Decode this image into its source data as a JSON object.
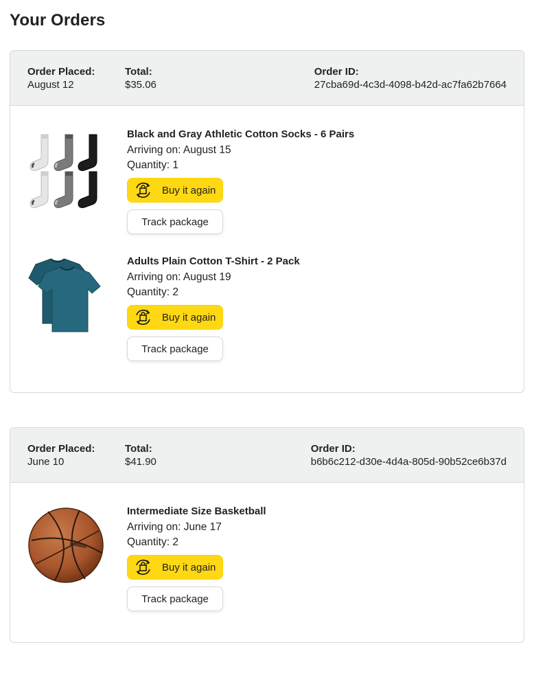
{
  "page": {
    "title": "Your Orders"
  },
  "labels": {
    "order_placed": "Order Placed:",
    "total": "Total:",
    "order_id": "Order ID:",
    "arriving_prefix": "Arriving on: ",
    "quantity_prefix": "Quantity: ",
    "buy_again": "Buy it again",
    "track_package": "Track package"
  },
  "orders": [
    {
      "placed": "August 12",
      "total": "$35.06",
      "id": "27cba69d-4c3d-4098-b42d-ac7fa62b7664",
      "items": [
        {
          "name": "Black and Gray Athletic Cotton Socks - 6 Pairs",
          "arriving": "August 15",
          "quantity": "1",
          "image": "socks-image"
        },
        {
          "name": "Adults Plain Cotton T-Shirt - 2 Pack",
          "arriving": "August 19",
          "quantity": "2",
          "image": "tshirt-image"
        }
      ]
    },
    {
      "placed": "June 10",
      "total": "$41.90",
      "id": "b6b6c212-d30e-4d4a-805d-90b52ce6b37d",
      "items": [
        {
          "name": "Intermediate Size Basketball",
          "arriving": "June 17",
          "quantity": "2",
          "image": "basketball-image"
        }
      ]
    }
  ],
  "colors": {
    "buy_button": "#ffd814",
    "header_bg": "#eff0f0",
    "border": "#d9d9d9"
  },
  "icons": {
    "buy_again": "buy-again-icon"
  }
}
